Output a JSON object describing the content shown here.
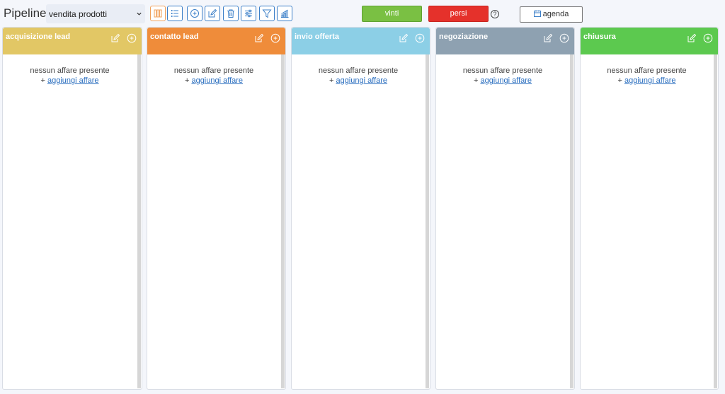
{
  "header": {
    "title": "Pipeline",
    "pipeline_select": "vendita prodotti",
    "won_label": "vinti",
    "lost_label": "persi",
    "help_label": "?",
    "agenda_label": "agenda"
  },
  "toolbar_icons": [
    "kanban-view-icon",
    "list-view-icon",
    "add-icon",
    "edit-icon",
    "delete-icon",
    "settings-sliders-icon",
    "filter-icon",
    "chart-icon"
  ],
  "colors": {
    "accent": "#3b7fc8",
    "won": "#7ac043",
    "lost": "#e5312b"
  },
  "columns": [
    {
      "title": "acquisizione lead",
      "color": "#e2c765",
      "empty_text": "nessun affare presente",
      "add_prefix": "+",
      "add_link": "aggiungi affare"
    },
    {
      "title": "contatto lead",
      "color": "#ef8c3a",
      "empty_text": "nessun affare presente",
      "add_prefix": "+",
      "add_link": "aggiungi affare"
    },
    {
      "title": "invio offerta",
      "color": "#8ccfe6",
      "empty_text": "nessun affare presente",
      "add_prefix": "+",
      "add_link": "aggiungi affare"
    },
    {
      "title": "negoziazione",
      "color": "#8ea1b1",
      "empty_text": "nessun affare presente",
      "add_prefix": "+",
      "add_link": "aggiungi affare"
    },
    {
      "title": "chiusura",
      "color": "#5cc94f",
      "empty_text": "nessun affare presente",
      "add_prefix": "+",
      "add_link": "aggiungi affare"
    }
  ]
}
